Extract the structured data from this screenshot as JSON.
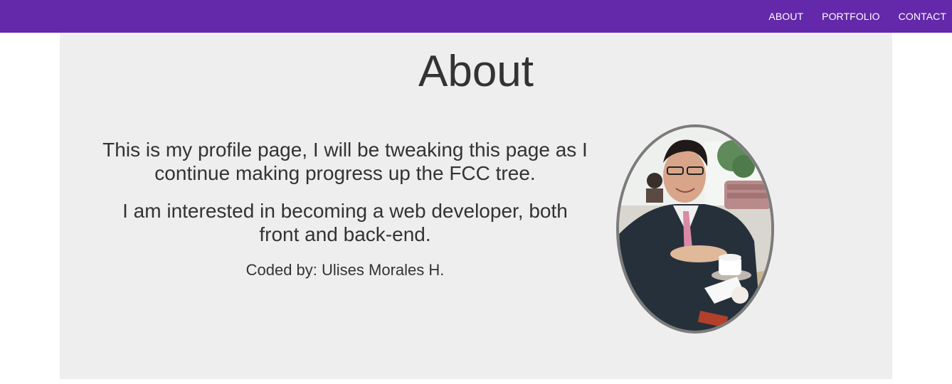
{
  "nav": {
    "items": [
      {
        "label": "ABOUT"
      },
      {
        "label": "PORTFOLIO"
      },
      {
        "label": "CONTACT"
      }
    ]
  },
  "main": {
    "title": "About",
    "paragraph1": "This is my profile page, I will be tweaking this page as I continue making progress up the FCC tree.",
    "paragraph2": "I am interested in becoming a web developer, both front and back-end.",
    "credit": "Coded by: Ulises Morales H."
  },
  "colors": {
    "navbar": "#6329aa",
    "content_bg": "#eeeeee",
    "text": "#333333",
    "photo_border": "#7b7b7b"
  }
}
